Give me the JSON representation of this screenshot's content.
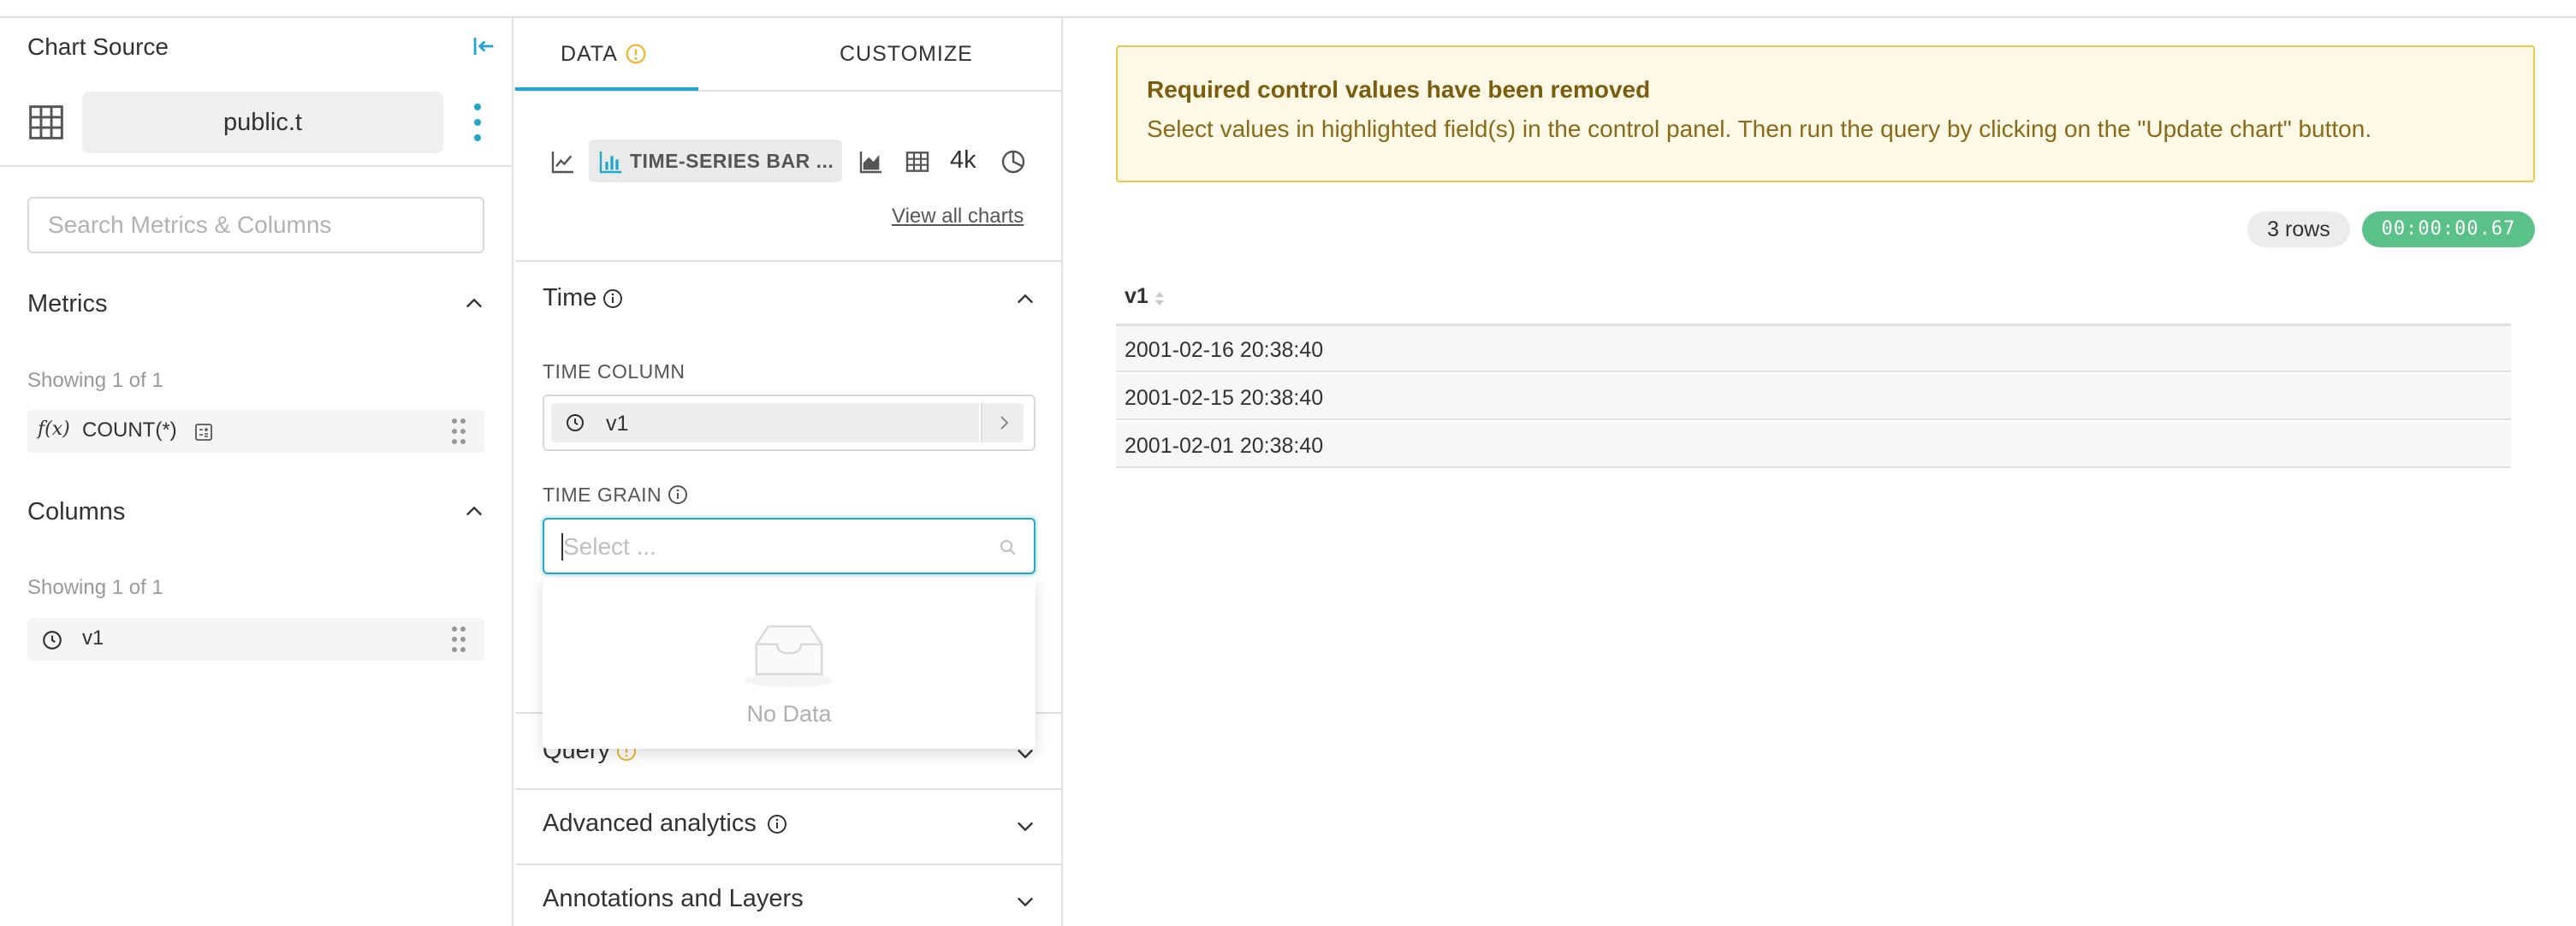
{
  "datasource": {
    "title": "Chart Source",
    "name": "public.t",
    "search_placeholder": "Search Metrics & Columns",
    "metrics": {
      "title": "Metrics",
      "showing": "Showing 1 of 1",
      "items": [
        {
          "prefix": "f(x)",
          "label": "COUNT(*)"
        }
      ]
    },
    "columns": {
      "title": "Columns",
      "showing": "Showing 1 of 1",
      "items": [
        {
          "label": "v1"
        }
      ]
    }
  },
  "control_panel": {
    "tabs": [
      {
        "label": "DATA",
        "active": true
      },
      {
        "label": "CUSTOMIZE",
        "active": false
      }
    ],
    "viz": {
      "active_label": "TIME-SERIES BAR ...",
      "shortcut_4k": "4k",
      "view_all": "View all charts"
    },
    "sections": {
      "time": "Time",
      "query": "Query",
      "advanced": "Advanced analytics",
      "annotations": "Annotations and Layers"
    },
    "time_column": {
      "label": "TIME COLUMN",
      "value": "v1"
    },
    "time_grain": {
      "label": "TIME GRAIN",
      "placeholder": "Select ...",
      "empty_text": "No Data"
    }
  },
  "chart": {
    "alert": {
      "title": "Required control values have been removed",
      "body": "Select values in highlighted field(s) in the control panel. Then run the query by clicking on the \"Update chart\" button."
    },
    "row_count": "3 rows",
    "duration": "00:00:00.67",
    "table": {
      "column": "v1",
      "rows": [
        "2001-02-16 20:38:40",
        "2001-02-15 20:38:40",
        "2001-02-01 20:38:40"
      ]
    }
  },
  "colors": {
    "accent": "#20a7c9",
    "warning_border": "#f0c74a",
    "warning_bg": "#fef9e6",
    "success": "#5ac189"
  }
}
